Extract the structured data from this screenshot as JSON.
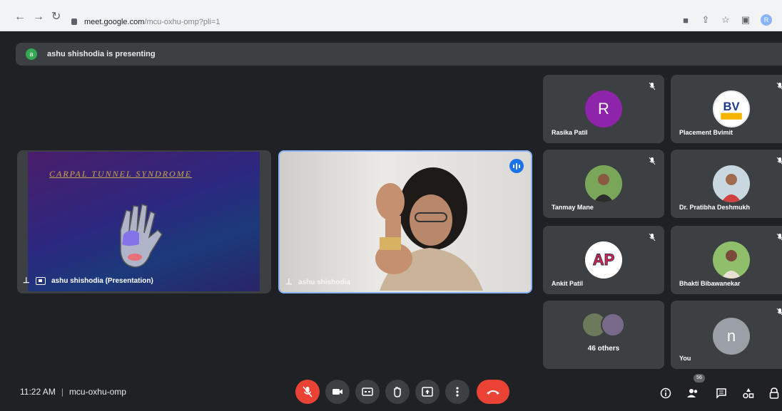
{
  "browser": {
    "url_domain": "meet.google.com",
    "url_path": "/mcu-oxhu-omp?pli=1",
    "profile_initial": "R"
  },
  "presenting_banner": {
    "initial": "a",
    "text": "ashu shishodia is presenting"
  },
  "presentation": {
    "slide_title": "CARPAL TUNNEL SYNDROME",
    "label": "ashu shishodia (Presentation)"
  },
  "camera": {
    "label": "ashu shishodia"
  },
  "participants": [
    {
      "name": "Rasika Patil",
      "initial": "R",
      "avatar_color": "#8e24aa",
      "muted": true
    },
    {
      "name": "Placement Bvimit",
      "avatar_text": "BV",
      "muted": true
    },
    {
      "name": "Tanmay Mane",
      "muted": true
    },
    {
      "name": "Dr. Pratibha Deshmukh",
      "muted": true
    },
    {
      "name": "Ankit Patil",
      "avatar_text": "AP",
      "muted": true
    },
    {
      "name": "Bhakti Bibawanekar",
      "muted": true
    }
  ],
  "others": {
    "label": "46 others"
  },
  "you_tile": {
    "name": "You",
    "initial": "n",
    "avatar_color": "#9aa0a6"
  },
  "bottom_bar": {
    "time": "11:22 AM",
    "meeting_code": "mcu-oxhu-omp",
    "people_count": "56"
  },
  "colors": {
    "background": "#202124",
    "tile": "#3c4043",
    "mic_off_red": "#ea4335",
    "speaking_blue": "#1a73e8"
  }
}
